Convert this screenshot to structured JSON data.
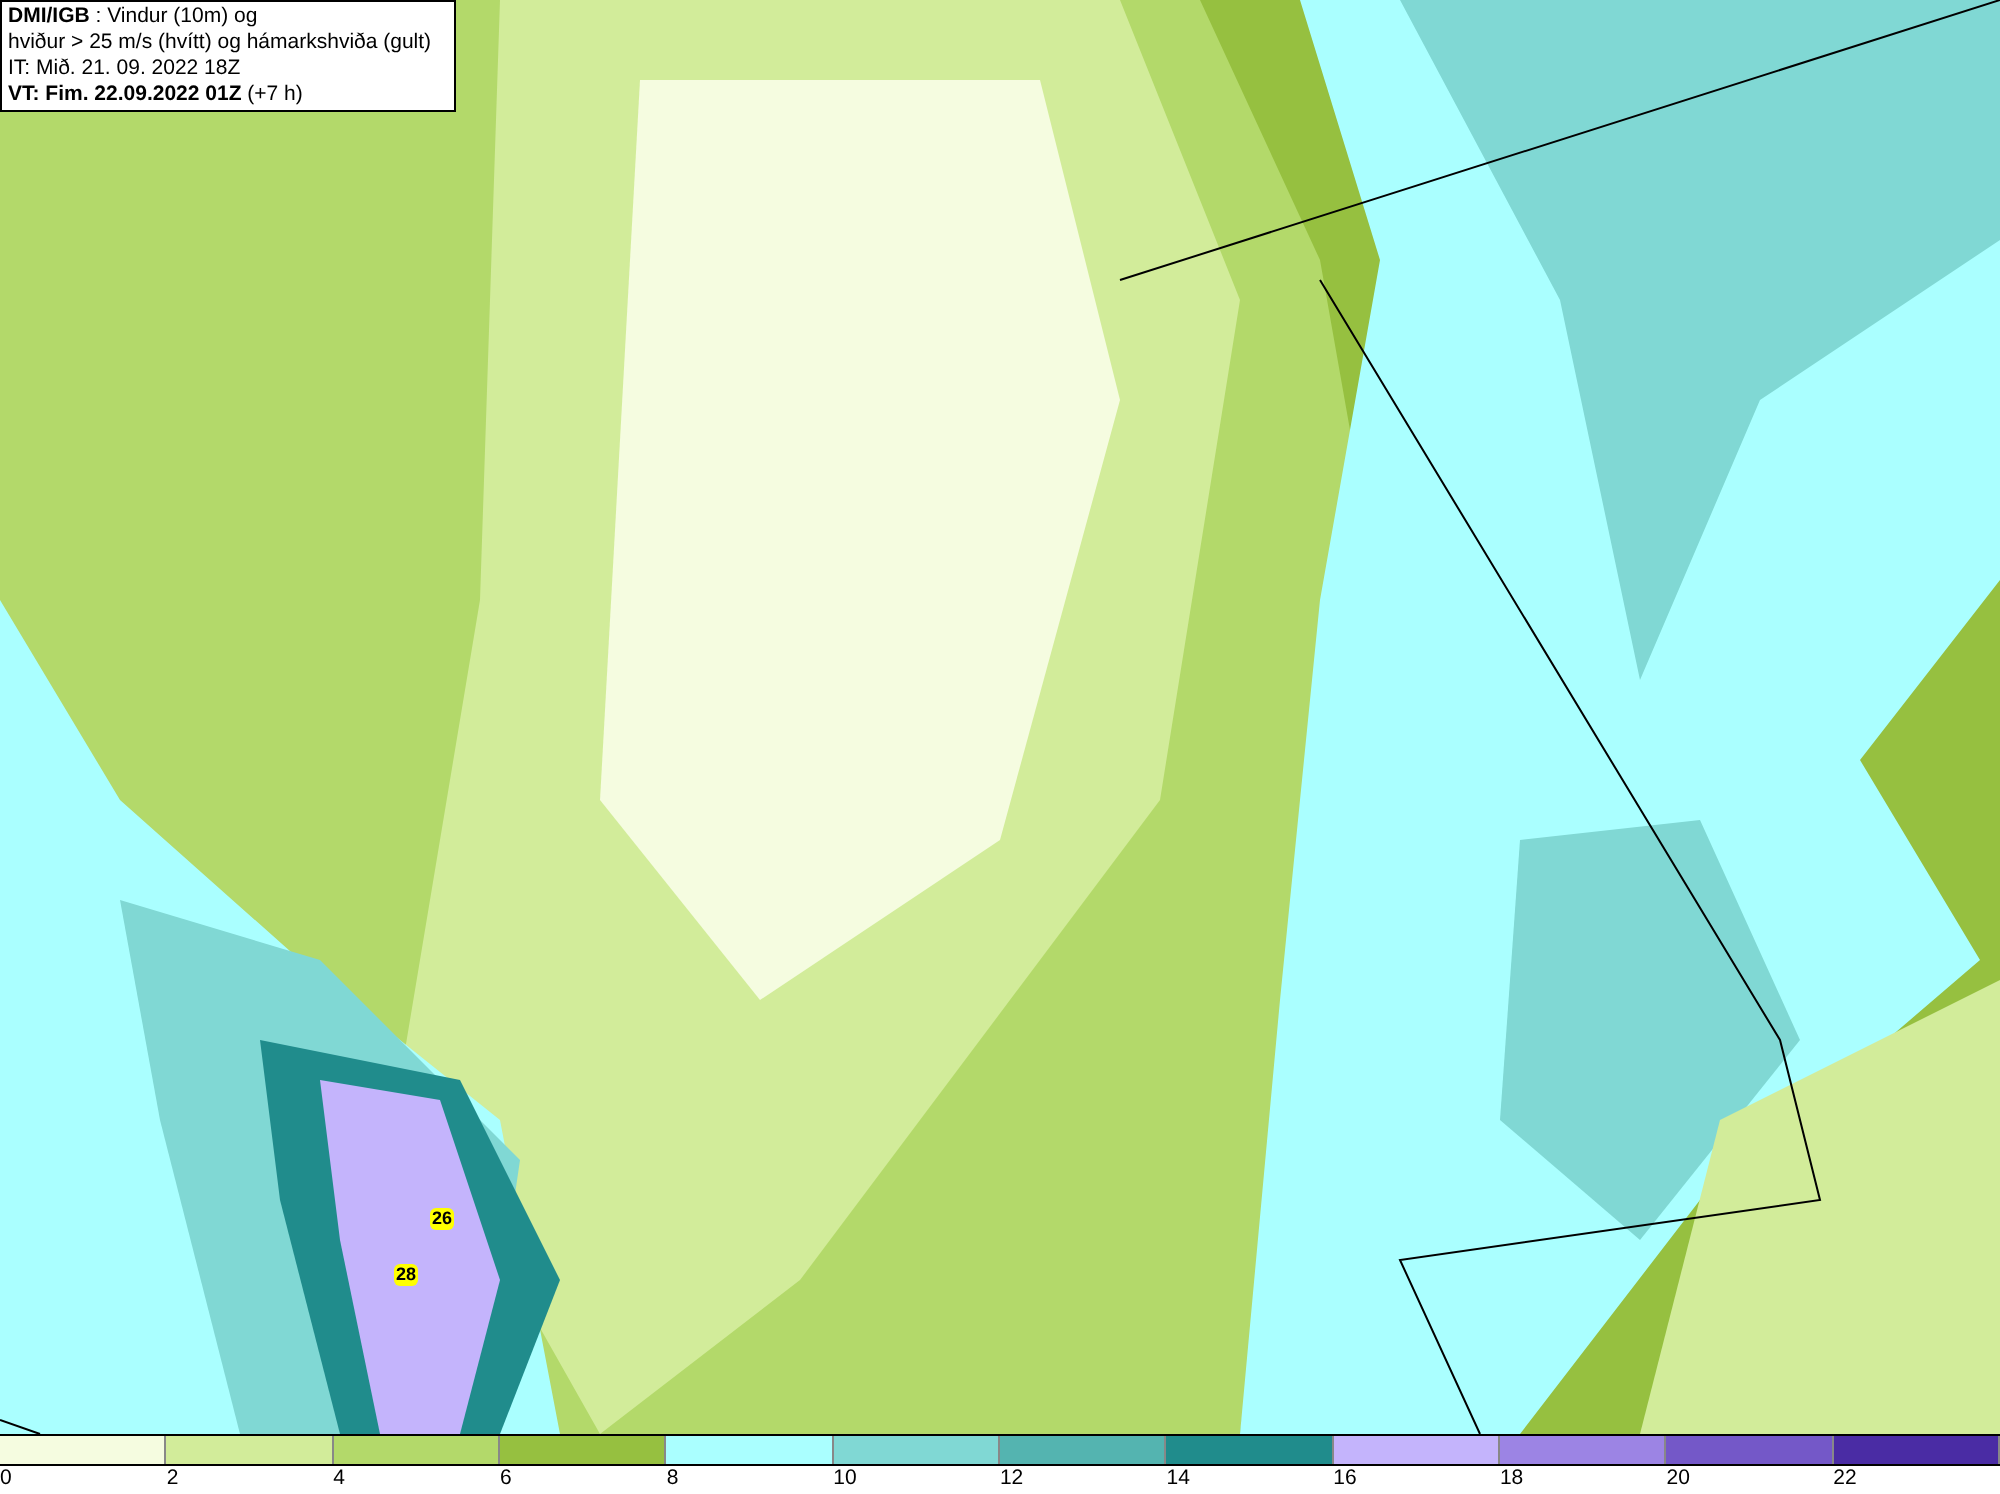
{
  "header": {
    "lines": [
      "**DMI/IGB** : Vindur (10m) og",
      "hviður > 25 m/s (hvítt) og hámarkshviða (gult)",
      "IT: Mið. 21. 09. 2022 18Z",
      "**VT: Fim. 22.09.2022 01Z** (+7 h)"
    ]
  },
  "map": {
    "gust_labels": [
      "26",
      "28"
    ]
  },
  "legend": {
    "bins": [
      {
        "color": "#f5fce0",
        "label": "0"
      },
      {
        "color": "#d2ec9a",
        "label": "2"
      },
      {
        "color": "#b3d96a",
        "label": "4"
      },
      {
        "color": "#96c040",
        "label": "6"
      },
      {
        "color": "#aaffff",
        "label": "8"
      },
      {
        "color": "#80d8d4",
        "label": "10"
      },
      {
        "color": "#54b4b0",
        "label": "12"
      },
      {
        "color": "#208c8c",
        "label": "14"
      },
      {
        "color": "#c4b4fc",
        "label": "16"
      },
      {
        "color": "#9c84e4",
        "label": "18"
      },
      {
        "color": "#7458c8",
        "label": "20"
      },
      {
        "color": "#4a2ca4",
        "label": "22"
      }
    ]
  }
}
